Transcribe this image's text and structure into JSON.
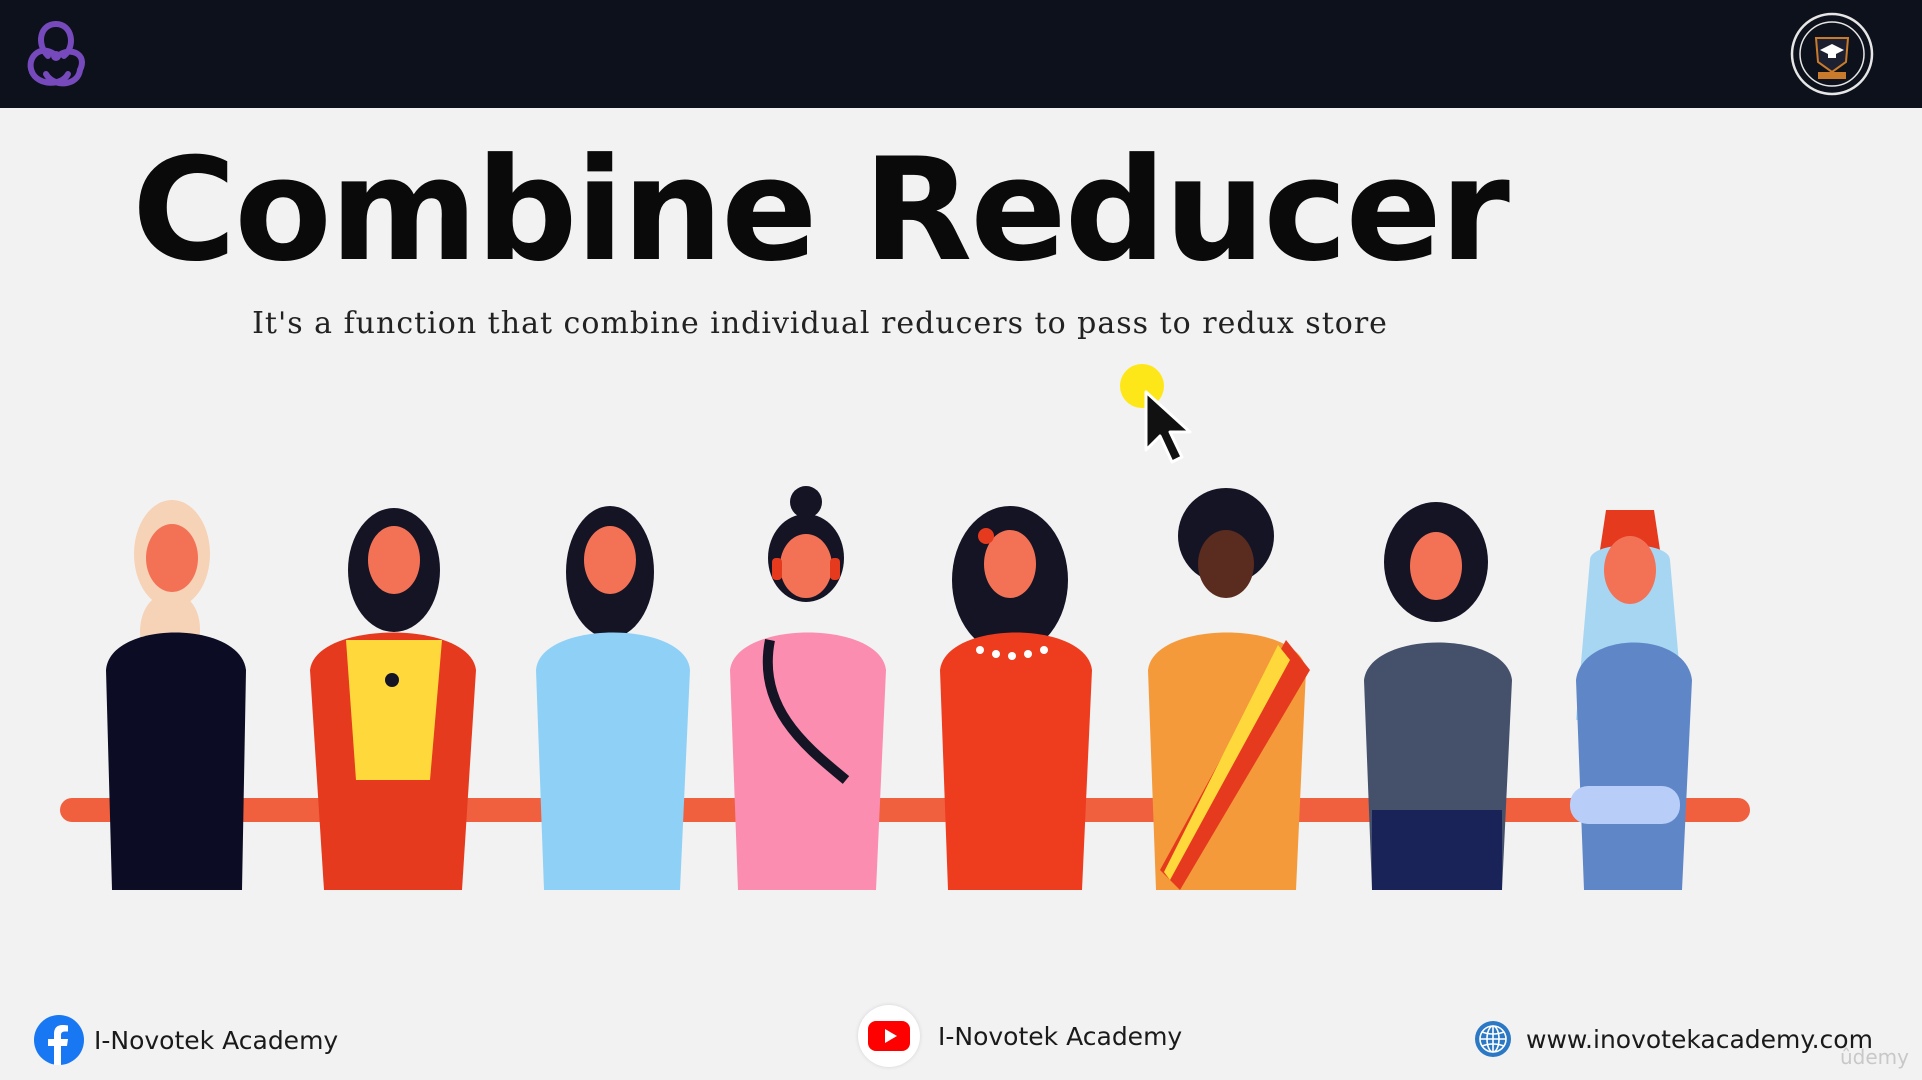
{
  "slide": {
    "title": "Combine Reducer",
    "subtitle": "It's a function that combine individual reducers to pass to redux store"
  },
  "header": {
    "left_logo_icon": "redux-logo-icon",
    "right_logo_icon": "academy-emblem-icon"
  },
  "footer": {
    "facebook": {
      "icon": "facebook-icon",
      "label": "I-Novotek Academy"
    },
    "youtube": {
      "icon": "youtube-icon",
      "label": "I-Novotek Academy"
    },
    "website": {
      "icon": "globe-icon",
      "label": "www.inovotekacademy.com"
    }
  },
  "watermark": "ûdemy",
  "colors": {
    "topbar": "#0d111b",
    "background": "#f2f2f2",
    "redux_purple": "#764abc",
    "cursor_highlight": "#ffe600"
  }
}
